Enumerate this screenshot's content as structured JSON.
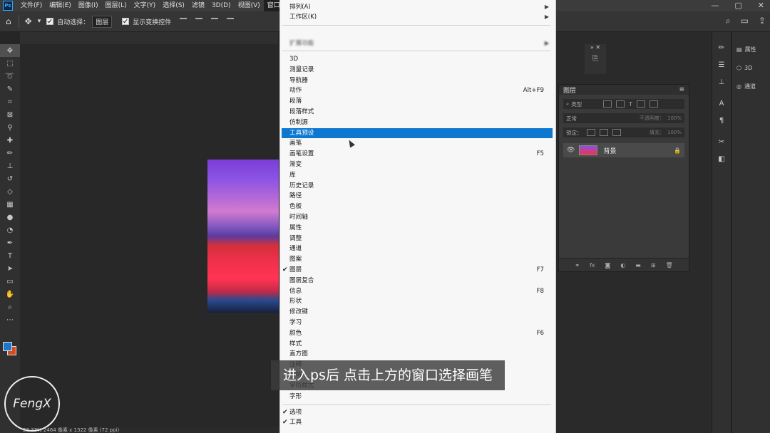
{
  "menubar": {
    "app_icon": "Ps",
    "items": [
      "文件(F)",
      "编辑(E)",
      "图像(I)",
      "图层(L)",
      "文字(Y)",
      "选择(S)",
      "滤镜",
      "3D(D)",
      "视图(V)",
      "窗口(W)"
    ],
    "window_controls": [
      "—",
      "▢",
      "✕"
    ]
  },
  "options": {
    "auto_select_label": "自动选择：",
    "auto_select_value": "图层",
    "show_transform_label": "显示变换控件",
    "right_icons": [
      "search-icon",
      "workspace-icon",
      "share-icon"
    ]
  },
  "menu": {
    "top_items": [
      {
        "label": "排列(A)",
        "arrow": "▶"
      },
      {
        "label": "工作区(K)",
        "arrow": "▶"
      }
    ],
    "ext_items": [
      {
        "label": "扩展功能",
        "arrow": "▶",
        "blur": true
      }
    ],
    "panel_items": [
      {
        "label": "3D",
        "shortcut": ""
      },
      {
        "label": "测量记录",
        "shortcut": ""
      },
      {
        "label": "导航器",
        "shortcut": ""
      },
      {
        "label": "动作",
        "shortcut": "Alt+F9"
      },
      {
        "label": "段落",
        "shortcut": ""
      },
      {
        "label": "段落样式",
        "shortcut": ""
      },
      {
        "label": "仿制源",
        "shortcut": ""
      },
      {
        "label": "工具预设",
        "shortcut": "",
        "highlight": true
      },
      {
        "label": "画笔",
        "shortcut": ""
      },
      {
        "label": "画笔设置",
        "shortcut": "F5"
      },
      {
        "label": "渐变",
        "shortcut": ""
      },
      {
        "label": "库",
        "shortcut": ""
      },
      {
        "label": "历史记录",
        "shortcut": ""
      },
      {
        "label": "路径",
        "shortcut": ""
      },
      {
        "label": "色板",
        "shortcut": ""
      },
      {
        "label": "时间轴",
        "shortcut": ""
      },
      {
        "label": "属性",
        "shortcut": ""
      },
      {
        "label": "调整",
        "shortcut": ""
      },
      {
        "label": "通道",
        "shortcut": ""
      },
      {
        "label": "图案",
        "shortcut": ""
      },
      {
        "label": "图层",
        "shortcut": "F7",
        "checked": true
      },
      {
        "label": "图层复合",
        "shortcut": ""
      },
      {
        "label": "信息",
        "shortcut": "F8"
      },
      {
        "label": "形状",
        "shortcut": ""
      },
      {
        "label": "修改键",
        "shortcut": ""
      },
      {
        "label": "学习",
        "shortcut": ""
      },
      {
        "label": "颜色",
        "shortcut": "F6"
      },
      {
        "label": "样式",
        "shortcut": ""
      },
      {
        "label": "直方图",
        "shortcut": ""
      },
      {
        "label": "注释",
        "shortcut": ""
      },
      {
        "label": "字符",
        "shortcut": ""
      },
      {
        "label": "字符样式",
        "shortcut": ""
      },
      {
        "label": "字形",
        "shortcut": ""
      }
    ],
    "bottom_items": [
      {
        "label": "选项",
        "checked": true
      },
      {
        "label": "工具",
        "checked": true
      }
    ]
  },
  "layers_panel": {
    "title": "图层",
    "filter_label": "类型",
    "blend_mode": "正常",
    "opacity_label": "不透明度：",
    "opacity_value": "100%",
    "lock_label": "锁定：",
    "fill_label": "填充：",
    "fill_value": "100%",
    "layer_name": "背景"
  },
  "properties": {
    "items": [
      "属性",
      "3D",
      "通道"
    ]
  },
  "status_bar": "23.33%   2464 像素 x 1322 像素 (72 ppi)",
  "subtitle": "进入ps后 点击上方的窗口选择画笔",
  "watermark": "FengX",
  "colors": {
    "highlight": "#0c78d0",
    "foreground_swatch": "#1e78c8",
    "background_swatch": "#d84a20"
  }
}
